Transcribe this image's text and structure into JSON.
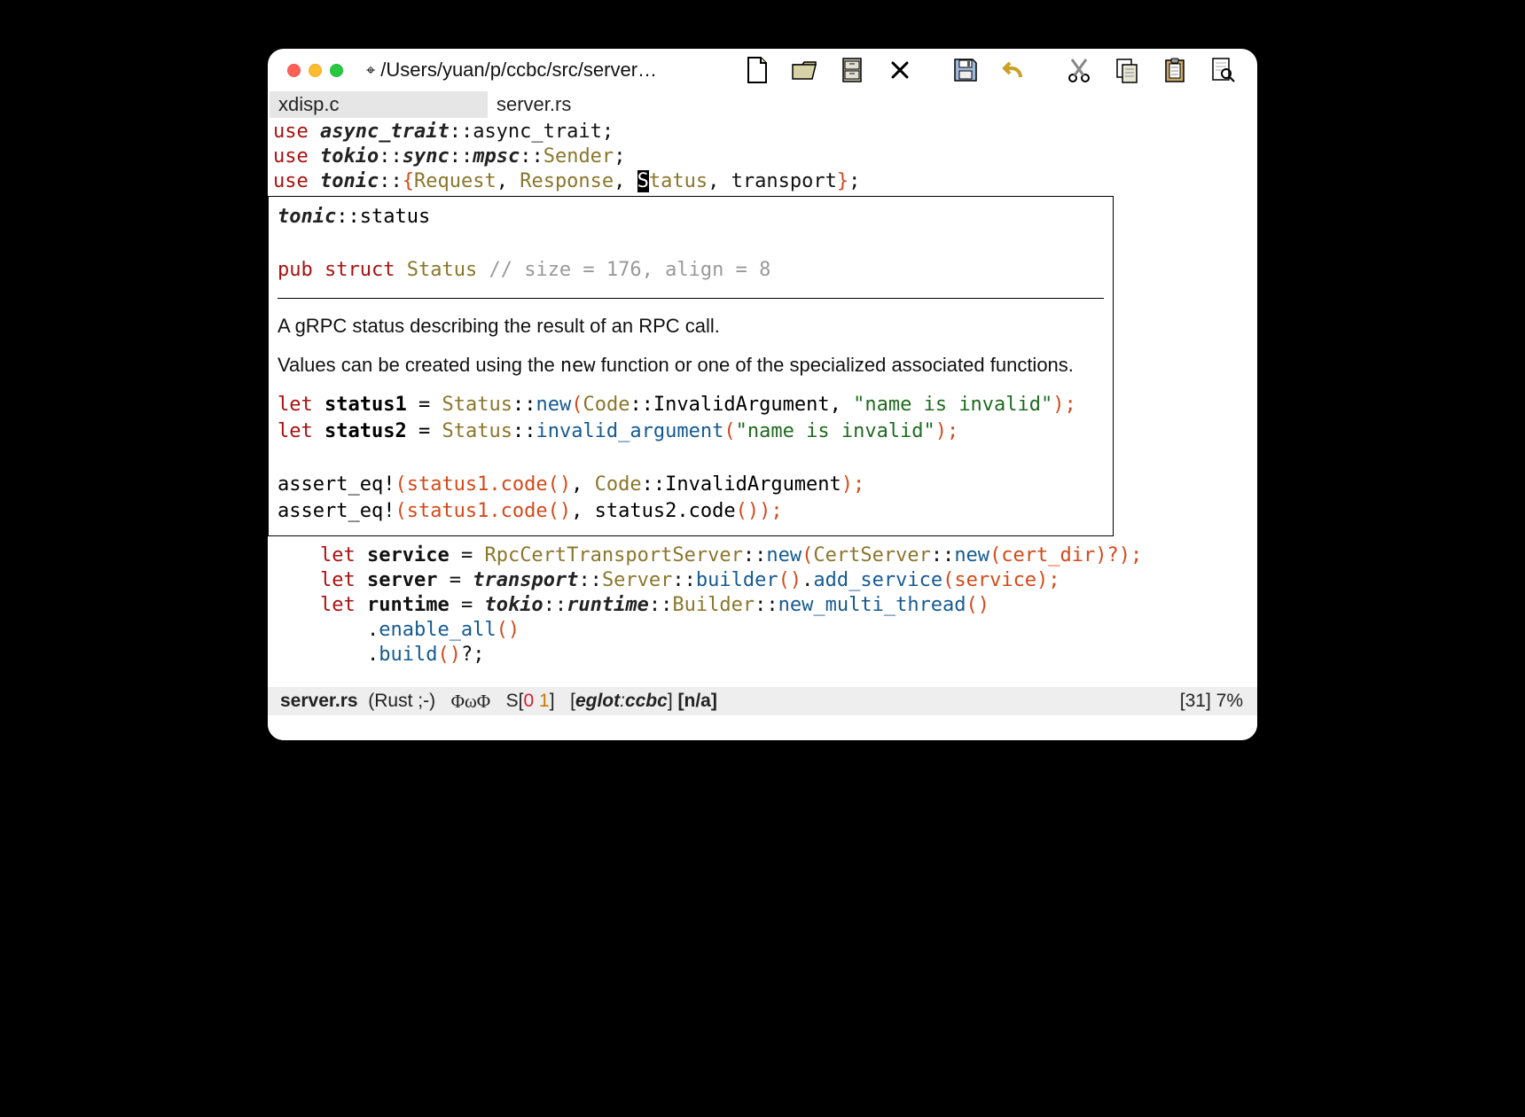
{
  "window": {
    "dirty_marker": "⌖",
    "title": "/Users/yuan/p/ccbc/src/server…"
  },
  "toolbar": {
    "new_icon": "new-file",
    "open_icon": "folder-open",
    "archive_icon": "archive",
    "close_icon": "✕",
    "save_icon": "save",
    "undo_icon": "undo",
    "cut_icon": "cut",
    "copy_icon": "copy",
    "paste_icon": "paste",
    "find_icon": "find"
  },
  "tabs": [
    {
      "label": "xdisp.c",
      "active": true
    },
    {
      "label": "server.rs",
      "active": false
    }
  ],
  "code": {
    "l1_use": "use",
    "l1_crate": "async_trait",
    "l1_tail": "::async_trait;",
    "l2_use": "use",
    "l2_crate": "tokio",
    "l2_p1": "::",
    "l2_sync": "sync",
    "l2_p2": "::",
    "l2_mpsc": "mpsc",
    "l2_p3": "::",
    "l2_sender": "Sender",
    "l2_semi": ";",
    "l3_use": "use",
    "l3_crate": "tonic",
    "l3_p1": "::",
    "l3_lb": "{",
    "l3_req": "Request",
    "l3_c1": ", ",
    "l3_resp": "Response",
    "l3_c2": ", ",
    "l3_cur": "S",
    "l3_stat_tail": "tatus",
    "l3_c3": ", ",
    "l3_tr": "transport",
    "l3_rb": "}",
    "l3_semi": ";"
  },
  "hover": {
    "path_crate": "tonic",
    "path_tail": "::status",
    "sig_pub": "pub",
    "sig_struct": "struct",
    "sig_name": "Status",
    "sig_comment": " // size = 176, align = 8",
    "doc_p1": "A gRPC status describing the result of an RPC call.",
    "doc_p2a": "Values can be created using the ",
    "doc_p2_code": "new",
    "doc_p2b": " function or one of the specialized associated functions.",
    "ex": {
      "l1_let": "let",
      "l1_var": "status1",
      "l1_eq": " = ",
      "l1_ty": "Status",
      "l1_p1": "::",
      "l1_fn": "new",
      "l1_lp": "(",
      "l1_code": "Code",
      "l1_cc": "::InvalidArgument",
      "l1_c": ", ",
      "l1_str": "\"name is invalid\"",
      "l1_tail": ");",
      "l2_let": "let",
      "l2_var": "status2",
      "l2_eq": " = ",
      "l2_ty": "Status",
      "l2_p1": "::",
      "l2_fn": "invalid_argument",
      "l2_lp": "(",
      "l2_str": "\"name is invalid\"",
      "l2_tail": ");",
      "l3_a": "assert_eq!",
      "l3_b": "(status1.code",
      "l3_par": "()",
      "l3_c": ", ",
      "l3_code": "Code",
      "l3_cc": "::InvalidArgument",
      "l3_tail": ");",
      "l4_a": "assert_eq!",
      "l4_b": "(status1.code",
      "l4_par1": "()",
      "l4_c": ", status2.code",
      "l4_par2": "()",
      "l4_tail": ");"
    }
  },
  "code2": {
    "l1_indent": "    ",
    "l1_let": "let",
    "l1_var": "service",
    "l1_eq": " = ",
    "l1_ty": "RpcCertTransportServer",
    "l1_p1": "::",
    "l1_fn": "new",
    "l1_lp": "(",
    "l1_ty2": "CertServer",
    "l1_p2": "::",
    "l1_fn2": "new",
    "l1_tail": "(cert_dir)?);",
    "l2_indent": "    ",
    "l2_let": "let",
    "l2_var": "server",
    "l2_eq": " = ",
    "l2_tr": "transport",
    "l2_p1": "::",
    "l2_srv": "Server",
    "l2_p2": "::",
    "l2_fn1": "builder",
    "l2_par1": "()",
    "l2_dot": ".",
    "l2_fn2": "add_service",
    "l2_tail": "(service);",
    "l3_indent": "    ",
    "l3_let": "let",
    "l3_var": "runtime",
    "l3_eq": " = ",
    "l3_tok": "tokio",
    "l3_p1": "::",
    "l3_rt": "runtime",
    "l3_p2": "::",
    "l3_bld": "Builder",
    "l3_p3": "::",
    "l3_fn": "new_multi_thread",
    "l3_par": "()",
    "l4_indent": "        .",
    "l4_fn": "enable_all",
    "l4_par": "()",
    "l5_indent": "        .",
    "l5_fn": "build",
    "l5_par": "()",
    "l5_tail": "?;"
  },
  "modeline": {
    "file": "server.rs",
    "lang": "(Rust ;-)",
    "omega": "ΦωΦ",
    "flycheck_label": "S",
    "flycheck_lb": "[",
    "flycheck_err": "0",
    "flycheck_warn": "1",
    "flycheck_rb": "]",
    "eglot_lb": "[",
    "eglot_i": "eglot",
    "eglot_sep": ":",
    "eglot_prj": "ccbc",
    "eglot_rb": "]",
    "na": "[n/a]",
    "pos": "[31] 7%"
  }
}
